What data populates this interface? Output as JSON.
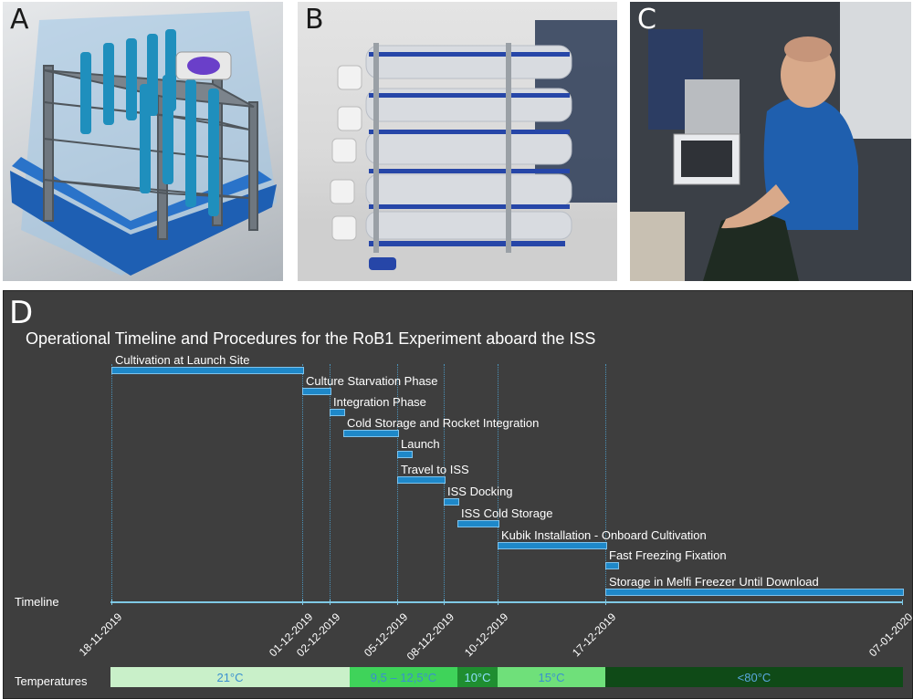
{
  "panels": {
    "a_letter": "A",
    "b_letter": "B",
    "c_letter": "C",
    "d_letter": "D"
  },
  "timeline": {
    "title": "Operational Timeline and Procedures for the RoB1 Experiment aboard the ISS",
    "axis_label": "Timeline",
    "temperatures_label": "Temperatures",
    "phases": [
      {
        "label": "Cultivation at Launch Site",
        "start": "18-11-2019",
        "end": "01-12-2019"
      },
      {
        "label": "Culture Starvation Phase",
        "start": "01-12-2019",
        "end": "02-12-2019"
      },
      {
        "label": "Integration Phase",
        "start": "02-12-2019",
        "end": "03-12-2019"
      },
      {
        "label": "Cold Storage and Rocket Integration",
        "start": "03-12-2019",
        "end": "05-12-2019"
      },
      {
        "label": "Launch",
        "start": "05-12-2019",
        "end": "06-12-2019"
      },
      {
        "label": "Travel to ISS",
        "start": "05-12-2019",
        "end": "08-12-2019"
      },
      {
        "label": "ISS Docking",
        "start": "08-12-2019",
        "end": "09-12-2019"
      },
      {
        "label": "ISS Cold Storage",
        "start": "09-12-2019",
        "end": "10-12-2019"
      },
      {
        "label": "Kubik Installation - Onboard Cultivation",
        "start": "10-12-2019",
        "end": "17-12-2019"
      },
      {
        "label": "Fast Freezing Fixation",
        "start": "17-12-2019",
        "end": "18-12-2019"
      },
      {
        "label": "Storage in Melfi Freezer Until Download",
        "start": "17-12-2019",
        "end": "07-01-2020"
      }
    ],
    "dates": [
      "18-11-2019",
      "01-12-2019",
      "02-12-2019",
      "05-12-2019",
      "08-112-2019",
      "10-12-2019",
      "17-12-2019",
      "07-01-2020"
    ],
    "temperatures": [
      {
        "label": "21°C",
        "color": "#c9f0c9",
        "text_color": "#3a8fd0"
      },
      {
        "label": "9,5 – 12,5°C",
        "color": "#3fd35a",
        "text_color": "#3a8fd0"
      },
      {
        "label": "10°C",
        "color": "#1f8e30",
        "text_color": "#8fe0ff"
      },
      {
        "label": "15°C",
        "color": "#6fe07a",
        "text_color": "#3a8fd0"
      },
      {
        "label": "<80°C",
        "color": "#0f4a17",
        "text_color": "#5aa9e0"
      }
    ]
  }
}
